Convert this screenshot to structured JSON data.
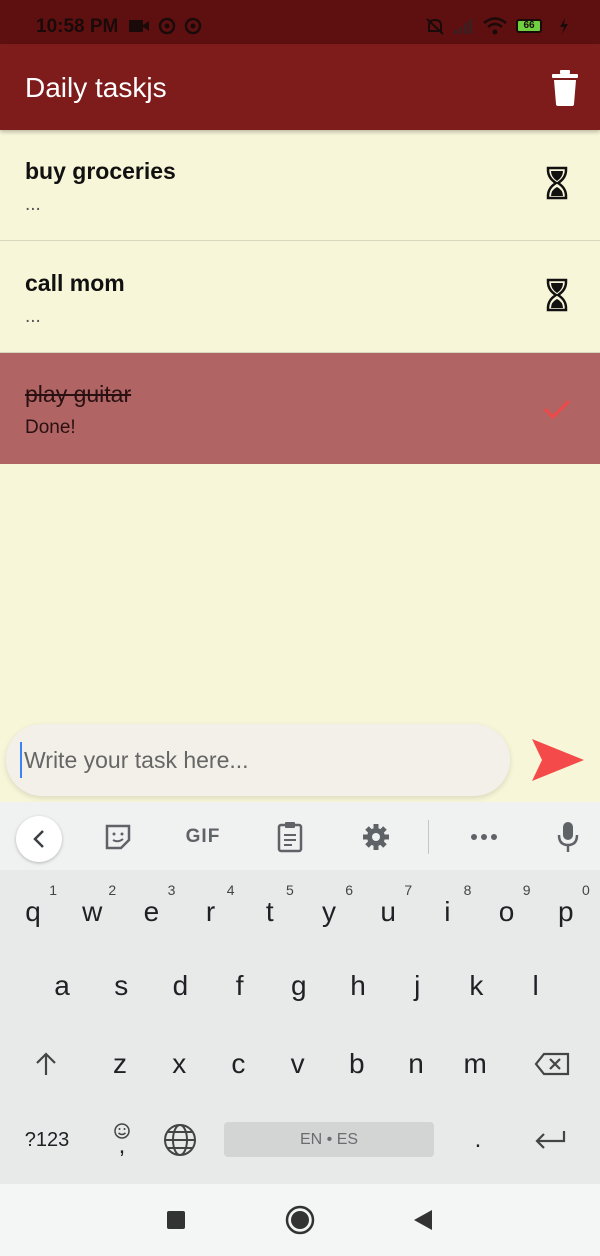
{
  "status_bar": {
    "time": "10:58 PM",
    "battery": "66"
  },
  "app_bar": {
    "title": "Daily taskjs"
  },
  "tasks": [
    {
      "title": "buy groceries",
      "subtitle": "...",
      "status": "pending"
    },
    {
      "title": "call mom",
      "subtitle": "...",
      "status": "pending"
    },
    {
      "title": "play guitar",
      "subtitle": "Done!",
      "status": "done"
    }
  ],
  "input": {
    "placeholder": "Write your task here...",
    "value": ""
  },
  "keyboard": {
    "toolbar": {
      "gif_label": "GIF"
    },
    "row1": [
      {
        "key": "q",
        "num": "1"
      },
      {
        "key": "w",
        "num": "2"
      },
      {
        "key": "e",
        "num": "3"
      },
      {
        "key": "r",
        "num": "4"
      },
      {
        "key": "t",
        "num": "5"
      },
      {
        "key": "y",
        "num": "6"
      },
      {
        "key": "u",
        "num": "7"
      },
      {
        "key": "i",
        "num": "8"
      },
      {
        "key": "o",
        "num": "9"
      },
      {
        "key": "p",
        "num": "0"
      }
    ],
    "row2": [
      "a",
      "s",
      "d",
      "f",
      "g",
      "h",
      "j",
      "k",
      "l"
    ],
    "row3": [
      "z",
      "x",
      "c",
      "v",
      "b",
      "n",
      "m"
    ],
    "symbols_label": "?123",
    "comma_label": ",",
    "period_label": ".",
    "space_label": "EN • ES"
  },
  "colors": {
    "status_bar": "#5e1010",
    "app_bar": "#7e1b1b",
    "background": "#f8f6d8",
    "done_row": "#b06464",
    "send_accent": "#f44a4a"
  }
}
